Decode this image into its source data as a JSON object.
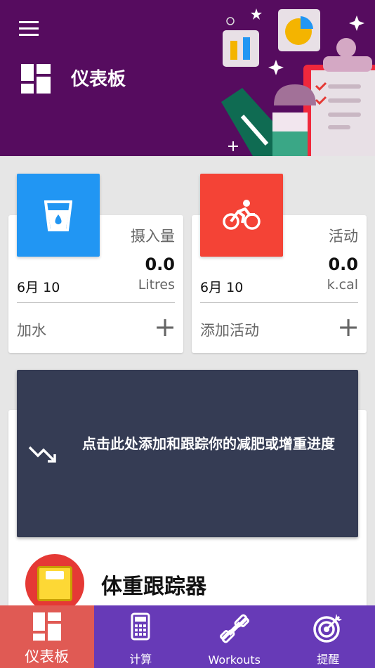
{
  "header": {
    "title": "仪表板",
    "menu_icon": "hamburger-icon",
    "colors": {
      "background": "#560c5f"
    }
  },
  "cards": [
    {
      "label": "摄入量",
      "value": "0.0",
      "date": "6月 10",
      "unit": "Litres",
      "action": "加水",
      "icon": "water-glass-icon",
      "color": "#2196f3"
    },
    {
      "label": "活动",
      "value": "0.0",
      "date": "6月 10",
      "unit": "k.cal",
      "action": "添加活动",
      "icon": "cyclist-icon",
      "color": "#f44336"
    }
  ],
  "banner": {
    "text": "点击此处添加和跟踪你的减肥或增重进度",
    "icon": "trend-down-icon"
  },
  "weight": {
    "title": "体重跟踪器",
    "icon": "scale-icon"
  },
  "nav": [
    {
      "label": "仪表板",
      "icon": "dashboard-icon",
      "active": true
    },
    {
      "label": "计算",
      "icon": "calculator-icon"
    },
    {
      "label": "Workouts",
      "icon": "dumbbell-icon"
    },
    {
      "label": "提醒",
      "icon": "target-icon"
    }
  ]
}
